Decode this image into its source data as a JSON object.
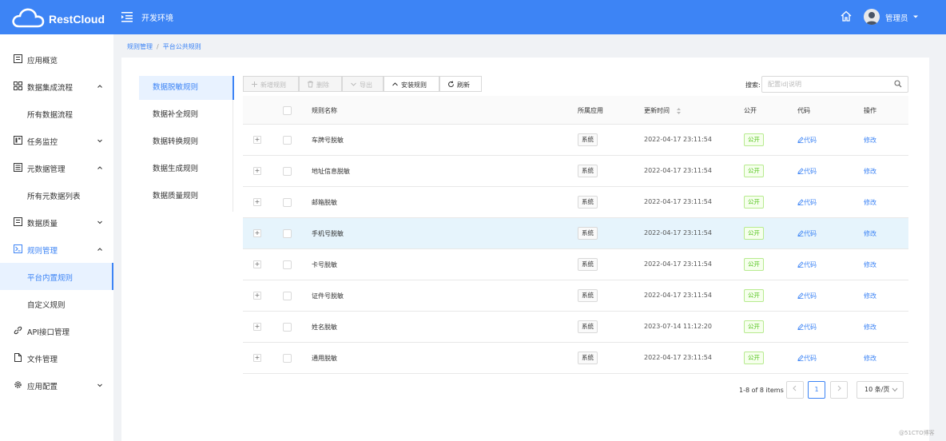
{
  "header": {
    "brand": "RestCloud",
    "env_title": "开发环境",
    "user_name": "管理员",
    "accent": "#3d84f5"
  },
  "sidebar": {
    "items": [
      {
        "label": "应用概览",
        "icon": "overview-icon"
      },
      {
        "label": "数据集成流程",
        "icon": "grid-icon",
        "arrow": "up"
      },
      {
        "label": "所有数据流程",
        "sub": true
      },
      {
        "label": "任务监控",
        "icon": "monitor-icon",
        "arrow": "down"
      },
      {
        "label": "元数据管理",
        "icon": "metadata-icon",
        "arrow": "up"
      },
      {
        "label": "所有元数据列表",
        "sub": true
      },
      {
        "label": "数据质量",
        "icon": "quality-icon",
        "arrow": "down"
      },
      {
        "label": "规则管理",
        "icon": "rule-icon",
        "arrow": "up"
      },
      {
        "label": "平台内置规则",
        "sub": true,
        "active": true
      },
      {
        "label": "自定义规则",
        "sub": true
      },
      {
        "label": "API接口管理",
        "icon": "link-icon"
      },
      {
        "label": "文件管理",
        "icon": "file-icon"
      },
      {
        "label": "应用配置",
        "icon": "gear-icon",
        "arrow": "down"
      }
    ]
  },
  "breadcrumb": {
    "root": "规则管理",
    "current": "平台公共规则",
    "separator": "/"
  },
  "rule_tabs": [
    "数据脱敏规则",
    "数据补全规则",
    "数据转换规则",
    "数据生成规则",
    "数据质量规则"
  ],
  "toolbar": {
    "new_label": "新增规则",
    "delete_label": "删除",
    "export_label": "导出",
    "install_label": "安装规则",
    "refresh_label": "刷新",
    "search_label": "搜索:",
    "search_placeholder": "配置id|说明"
  },
  "table": {
    "columns": {
      "name": "规则名称",
      "app": "所属应用",
      "updated": "更新时间",
      "public": "公开",
      "code": "代码",
      "ops": "操作"
    },
    "rows": [
      {
        "name": "车牌号脱敏",
        "app": "系统",
        "updated": "2022-04-17 23:11:54",
        "public": "公开",
        "code": "代码",
        "op": "修改"
      },
      {
        "name": "地址信息脱敏",
        "app": "系统",
        "updated": "2022-04-17 23:11:54",
        "public": "公开",
        "code": "代码",
        "op": "修改"
      },
      {
        "name": "邮箱脱敏",
        "app": "系统",
        "updated": "2022-04-17 23:11:54",
        "public": "公开",
        "code": "代码",
        "op": "修改"
      },
      {
        "name": "手机号脱敏",
        "app": "系统",
        "updated": "2022-04-17 23:11:54",
        "public": "公开",
        "code": "代码",
        "op": "修改"
      },
      {
        "name": "卡号脱敏",
        "app": "系统",
        "updated": "2022-04-17 23:11:54",
        "public": "公开",
        "code": "代码",
        "op": "修改"
      },
      {
        "name": "证件号脱敏",
        "app": "系统",
        "updated": "2022-04-17 23:11:54",
        "public": "公开",
        "code": "代码",
        "op": "修改"
      },
      {
        "name": "姓名脱敏",
        "app": "系统",
        "updated": "2023-07-14 11:12:20",
        "public": "公开",
        "code": "代码",
        "op": "修改"
      },
      {
        "name": "通用脱敏",
        "app": "系统",
        "updated": "2022-04-17 23:11:54",
        "public": "公开",
        "code": "代码",
        "op": "修改"
      }
    ]
  },
  "pagination": {
    "total_text": "1-8 of 8 items",
    "current_page": "1",
    "page_size": "10 条/页"
  },
  "watermark": "@51CTO博客"
}
